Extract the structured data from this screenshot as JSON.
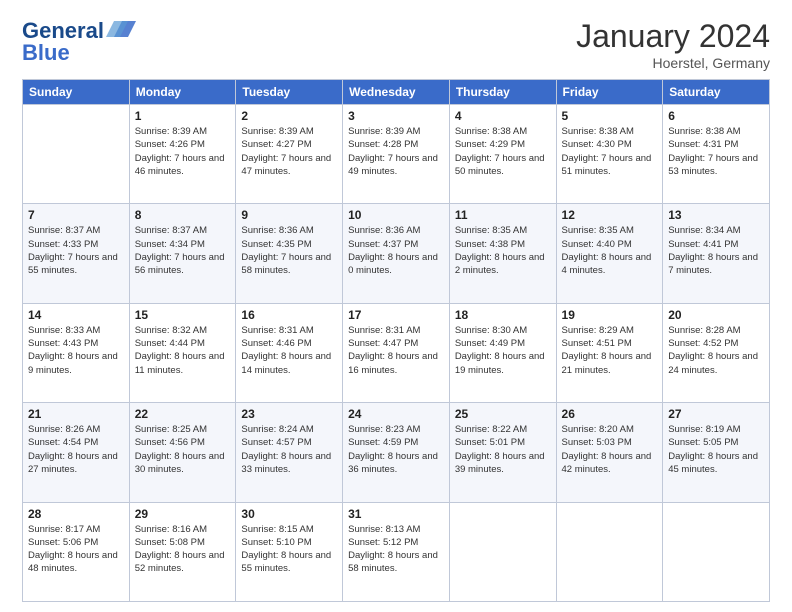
{
  "header": {
    "logo_line1": "General",
    "logo_line2": "Blue",
    "month": "January 2024",
    "location": "Hoerstel, Germany"
  },
  "weekdays": [
    "Sunday",
    "Monday",
    "Tuesday",
    "Wednesday",
    "Thursday",
    "Friday",
    "Saturday"
  ],
  "weeks": [
    [
      {
        "day": "",
        "sunrise": "",
        "sunset": "",
        "daylight": ""
      },
      {
        "day": "1",
        "sunrise": "Sunrise: 8:39 AM",
        "sunset": "Sunset: 4:26 PM",
        "daylight": "Daylight: 7 hours and 46 minutes."
      },
      {
        "day": "2",
        "sunrise": "Sunrise: 8:39 AM",
        "sunset": "Sunset: 4:27 PM",
        "daylight": "Daylight: 7 hours and 47 minutes."
      },
      {
        "day": "3",
        "sunrise": "Sunrise: 8:39 AM",
        "sunset": "Sunset: 4:28 PM",
        "daylight": "Daylight: 7 hours and 49 minutes."
      },
      {
        "day": "4",
        "sunrise": "Sunrise: 8:38 AM",
        "sunset": "Sunset: 4:29 PM",
        "daylight": "Daylight: 7 hours and 50 minutes."
      },
      {
        "day": "5",
        "sunrise": "Sunrise: 8:38 AM",
        "sunset": "Sunset: 4:30 PM",
        "daylight": "Daylight: 7 hours and 51 minutes."
      },
      {
        "day": "6",
        "sunrise": "Sunrise: 8:38 AM",
        "sunset": "Sunset: 4:31 PM",
        "daylight": "Daylight: 7 hours and 53 minutes."
      }
    ],
    [
      {
        "day": "7",
        "sunrise": "Sunrise: 8:37 AM",
        "sunset": "Sunset: 4:33 PM",
        "daylight": "Daylight: 7 hours and 55 minutes."
      },
      {
        "day": "8",
        "sunrise": "Sunrise: 8:37 AM",
        "sunset": "Sunset: 4:34 PM",
        "daylight": "Daylight: 7 hours and 56 minutes."
      },
      {
        "day": "9",
        "sunrise": "Sunrise: 8:36 AM",
        "sunset": "Sunset: 4:35 PM",
        "daylight": "Daylight: 7 hours and 58 minutes."
      },
      {
        "day": "10",
        "sunrise": "Sunrise: 8:36 AM",
        "sunset": "Sunset: 4:37 PM",
        "daylight": "Daylight: 8 hours and 0 minutes."
      },
      {
        "day": "11",
        "sunrise": "Sunrise: 8:35 AM",
        "sunset": "Sunset: 4:38 PM",
        "daylight": "Daylight: 8 hours and 2 minutes."
      },
      {
        "day": "12",
        "sunrise": "Sunrise: 8:35 AM",
        "sunset": "Sunset: 4:40 PM",
        "daylight": "Daylight: 8 hours and 4 minutes."
      },
      {
        "day": "13",
        "sunrise": "Sunrise: 8:34 AM",
        "sunset": "Sunset: 4:41 PM",
        "daylight": "Daylight: 8 hours and 7 minutes."
      }
    ],
    [
      {
        "day": "14",
        "sunrise": "Sunrise: 8:33 AM",
        "sunset": "Sunset: 4:43 PM",
        "daylight": "Daylight: 8 hours and 9 minutes."
      },
      {
        "day": "15",
        "sunrise": "Sunrise: 8:32 AM",
        "sunset": "Sunset: 4:44 PM",
        "daylight": "Daylight: 8 hours and 11 minutes."
      },
      {
        "day": "16",
        "sunrise": "Sunrise: 8:31 AM",
        "sunset": "Sunset: 4:46 PM",
        "daylight": "Daylight: 8 hours and 14 minutes."
      },
      {
        "day": "17",
        "sunrise": "Sunrise: 8:31 AM",
        "sunset": "Sunset: 4:47 PM",
        "daylight": "Daylight: 8 hours and 16 minutes."
      },
      {
        "day": "18",
        "sunrise": "Sunrise: 8:30 AM",
        "sunset": "Sunset: 4:49 PM",
        "daylight": "Daylight: 8 hours and 19 minutes."
      },
      {
        "day": "19",
        "sunrise": "Sunrise: 8:29 AM",
        "sunset": "Sunset: 4:51 PM",
        "daylight": "Daylight: 8 hours and 21 minutes."
      },
      {
        "day": "20",
        "sunrise": "Sunrise: 8:28 AM",
        "sunset": "Sunset: 4:52 PM",
        "daylight": "Daylight: 8 hours and 24 minutes."
      }
    ],
    [
      {
        "day": "21",
        "sunrise": "Sunrise: 8:26 AM",
        "sunset": "Sunset: 4:54 PM",
        "daylight": "Daylight: 8 hours and 27 minutes."
      },
      {
        "day": "22",
        "sunrise": "Sunrise: 8:25 AM",
        "sunset": "Sunset: 4:56 PM",
        "daylight": "Daylight: 8 hours and 30 minutes."
      },
      {
        "day": "23",
        "sunrise": "Sunrise: 8:24 AM",
        "sunset": "Sunset: 4:57 PM",
        "daylight": "Daylight: 8 hours and 33 minutes."
      },
      {
        "day": "24",
        "sunrise": "Sunrise: 8:23 AM",
        "sunset": "Sunset: 4:59 PM",
        "daylight": "Daylight: 8 hours and 36 minutes."
      },
      {
        "day": "25",
        "sunrise": "Sunrise: 8:22 AM",
        "sunset": "Sunset: 5:01 PM",
        "daylight": "Daylight: 8 hours and 39 minutes."
      },
      {
        "day": "26",
        "sunrise": "Sunrise: 8:20 AM",
        "sunset": "Sunset: 5:03 PM",
        "daylight": "Daylight: 8 hours and 42 minutes."
      },
      {
        "day": "27",
        "sunrise": "Sunrise: 8:19 AM",
        "sunset": "Sunset: 5:05 PM",
        "daylight": "Daylight: 8 hours and 45 minutes."
      }
    ],
    [
      {
        "day": "28",
        "sunrise": "Sunrise: 8:17 AM",
        "sunset": "Sunset: 5:06 PM",
        "daylight": "Daylight: 8 hours and 48 minutes."
      },
      {
        "day": "29",
        "sunrise": "Sunrise: 8:16 AM",
        "sunset": "Sunset: 5:08 PM",
        "daylight": "Daylight: 8 hours and 52 minutes."
      },
      {
        "day": "30",
        "sunrise": "Sunrise: 8:15 AM",
        "sunset": "Sunset: 5:10 PM",
        "daylight": "Daylight: 8 hours and 55 minutes."
      },
      {
        "day": "31",
        "sunrise": "Sunrise: 8:13 AM",
        "sunset": "Sunset: 5:12 PM",
        "daylight": "Daylight: 8 hours and 58 minutes."
      },
      {
        "day": "",
        "sunrise": "",
        "sunset": "",
        "daylight": ""
      },
      {
        "day": "",
        "sunrise": "",
        "sunset": "",
        "daylight": ""
      },
      {
        "day": "",
        "sunrise": "",
        "sunset": "",
        "daylight": ""
      }
    ]
  ]
}
